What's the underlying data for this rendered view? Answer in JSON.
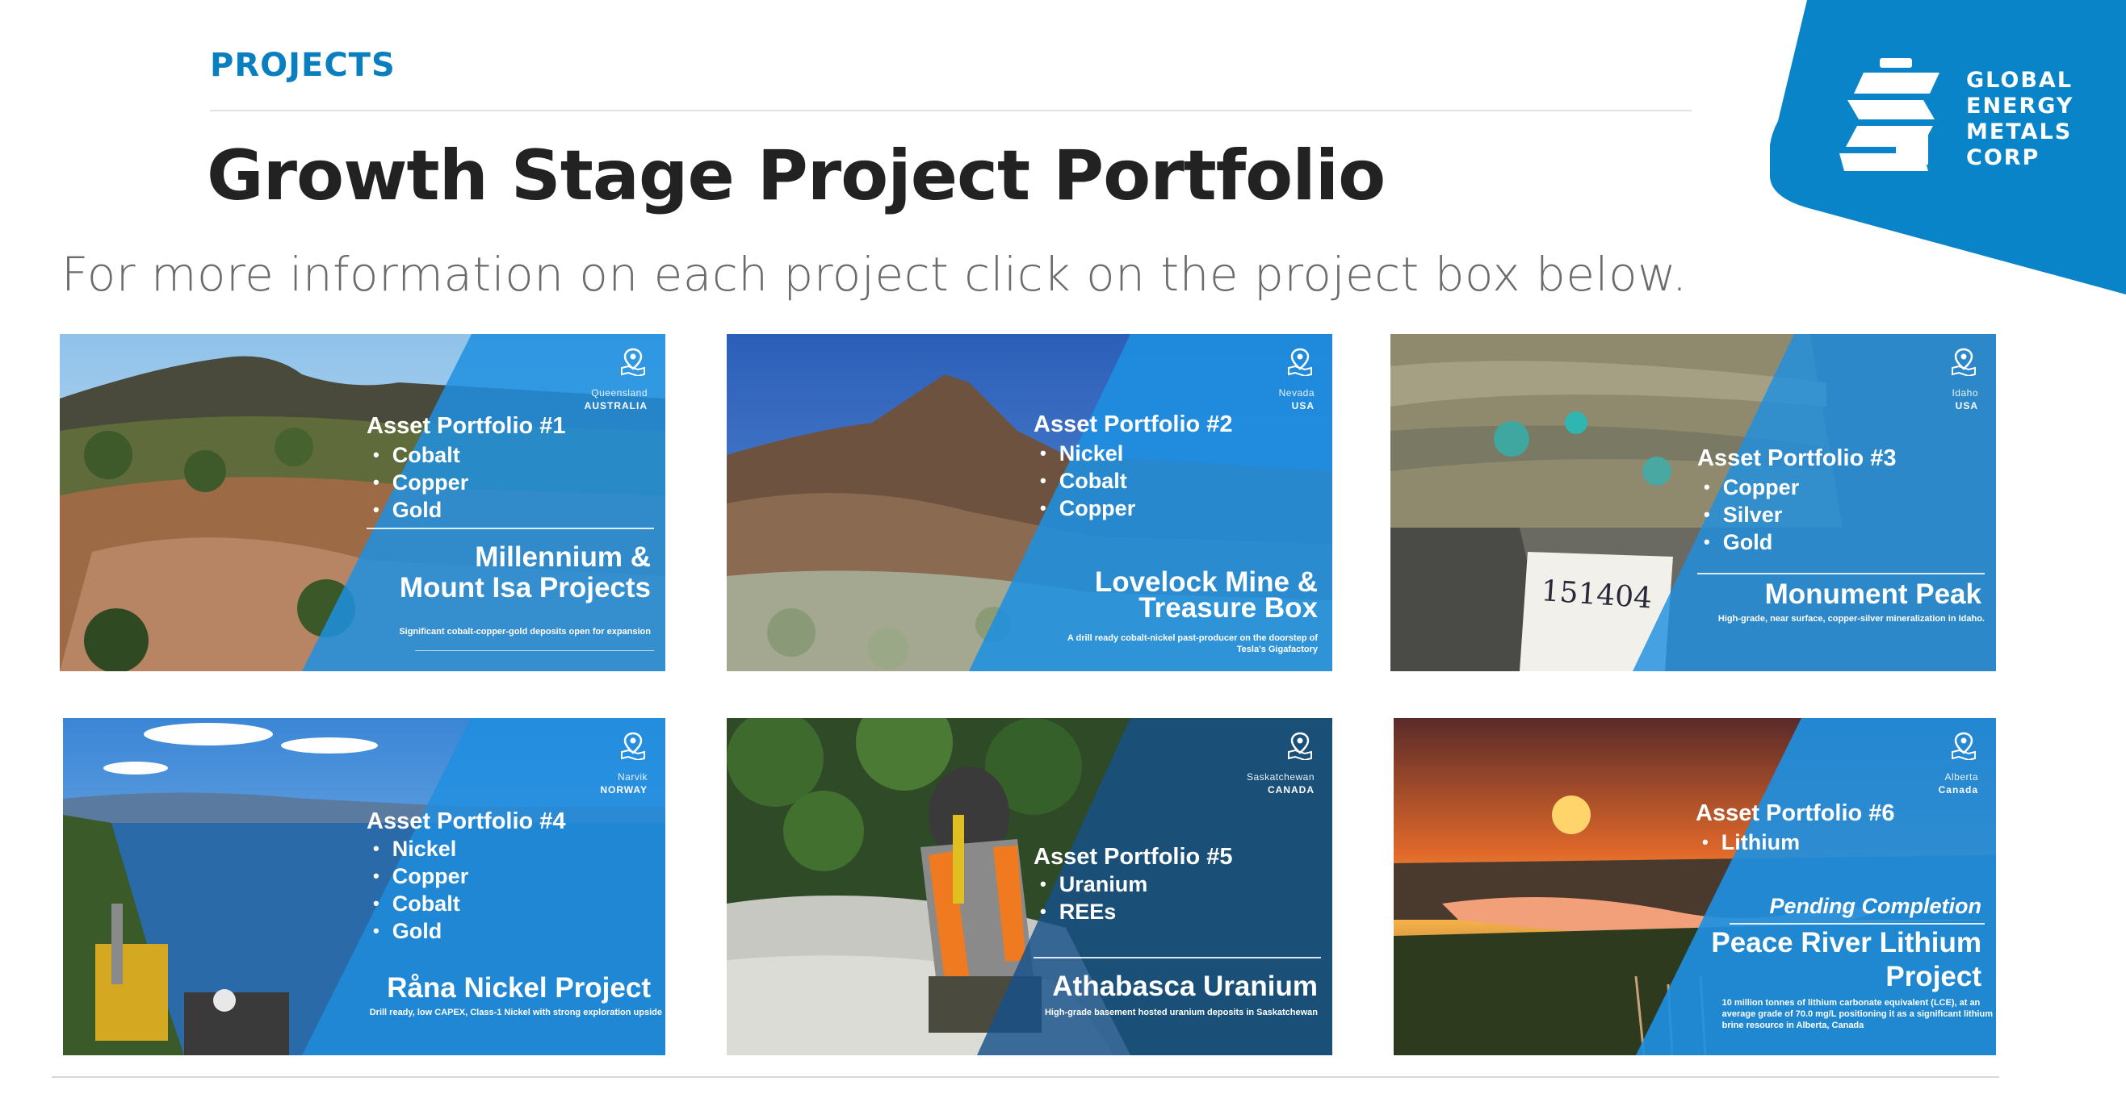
{
  "header": {
    "section_label": "PROJECTS",
    "title": "Growth Stage Project Portfolio",
    "subtitle": "For more information on each project click on the project box below."
  },
  "logo": {
    "lines": [
      "GLOBAL",
      "ENERGY",
      "METALS",
      "CORP"
    ],
    "icon": "gem-logo-icon",
    "color": "#0a84c8"
  },
  "colors": {
    "brand_blue": "#0a84c8",
    "overlay_blue": "#1e8fe0",
    "overlay_dark_blue": "#16508a"
  },
  "cards": [
    {
      "region": "Queensland",
      "country": "AUSTRALIA",
      "portfolio": "Asset Portfolio #1",
      "metals": [
        "Cobalt",
        "Copper",
        "Gold"
      ],
      "project": "Millennium &\nMount Isa Projects",
      "description": "Significant cobalt-copper-gold deposits open for expansion",
      "pin_icon": "map-pin-icon"
    },
    {
      "region": "Nevada",
      "country": "USA",
      "portfolio": "Asset Portfolio #2",
      "metals": [
        "Nickel",
        "Cobalt",
        "Copper"
      ],
      "project": "Lovelock Mine &\nTreasure Box",
      "description": "A drill ready cobalt-nickel past-producer on the doorstep of\nTesla's Gigafactory",
      "pin_icon": "map-pin-icon"
    },
    {
      "region": "Idaho",
      "country": "USA",
      "portfolio": "Asset Portfolio #3",
      "metals": [
        "Copper",
        "Silver",
        "Gold"
      ],
      "project": "Monument Peak",
      "description": "High-grade, near surface, copper-silver mineralization in Idaho.",
      "photo_text": "151404",
      "pin_icon": "map-pin-icon"
    },
    {
      "region": "Narvik",
      "country": "NORWAY",
      "portfolio": "Asset Portfolio #4",
      "metals": [
        "Nickel",
        "Copper",
        "Cobalt",
        "Gold"
      ],
      "project": "Råna Nickel Project",
      "description": "Drill ready, low CAPEX, Class-1 Nickel with strong exploration upside",
      "pin_icon": "map-pin-icon"
    },
    {
      "region": "Saskatchewan",
      "country": "CANADA",
      "portfolio": "Asset Portfolio #5",
      "metals": [
        "Uranium",
        "REEs"
      ],
      "project": "Athabasca Uranium",
      "description": "High-grade basement hosted uranium deposits  in Saskatchewan",
      "pin_icon": "map-pin-icon"
    },
    {
      "region": "Alberta",
      "country": "Canada",
      "portfolio": "Asset Portfolio #6",
      "metals": [
        "Lithium"
      ],
      "pending": "Pending Completion",
      "project": "Peace River Lithium\nProject",
      "description": "10 million tonnes of lithium carbonate equivalent (LCE), at an\naverage grade of 70.0 mg/L positioning it as a significant lithium\nbrine resource in Alberta, Canada",
      "pin_icon": "map-pin-icon"
    }
  ]
}
